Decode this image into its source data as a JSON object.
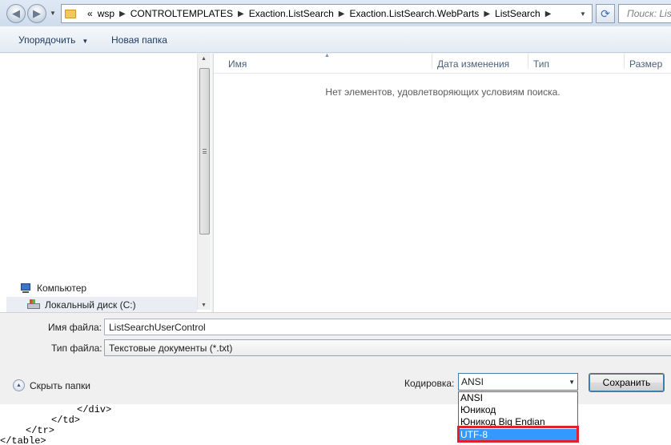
{
  "address_bar": {
    "overflow": "«",
    "crumbs": [
      "wsp",
      "CONTROLTEMPLATES",
      "Exaction.ListSearch",
      "Exaction.ListSearch.WebParts",
      "ListSearch"
    ]
  },
  "search": {
    "placeholder": "Поиск: ListSearch"
  },
  "toolbar": {
    "organize": "Упорядочить",
    "new_folder": "Новая папка"
  },
  "nav_pane": {
    "computer": "Компьютер",
    "local_disk": "Локальный диск (C:)"
  },
  "file_list": {
    "columns": [
      "Имя",
      "Дата изменения",
      "Тип",
      "Размер"
    ],
    "empty_message": "Нет элементов, удовлетворяющих условиям поиска."
  },
  "form": {
    "file_name_label": "Имя файла:",
    "file_name_value": "ListSearchUserControl",
    "file_type_label": "Тип файла:",
    "file_type_value": "Текстовые документы (*.txt)",
    "hide_folders": "Скрыть папки",
    "encoding_label": "Кодировка:",
    "encoding_value": "ANSI",
    "save_label": "Сохранить"
  },
  "encoding_options": [
    "ANSI",
    "Юникод",
    "Юникод Big Endian",
    "UTF-8"
  ],
  "encoding_selected": "UTF-8",
  "background_code": [
    "</div>",
    "</td>",
    "</tr>",
    "</table>"
  ],
  "colors": {
    "selection": "#3399ff",
    "highlight_box": "#e0202a"
  }
}
